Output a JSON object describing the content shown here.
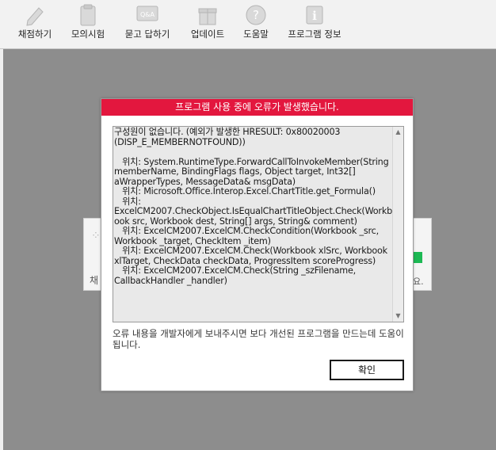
{
  "toolbar": {
    "items": [
      {
        "label": "채점하기",
        "icon": "pencil-icon"
      },
      {
        "label": "모의시험",
        "icon": "clipboard-icon"
      },
      {
        "label": "묻고 답하기",
        "icon": "qa-icon"
      },
      {
        "label": "업데이트",
        "icon": "gift-icon"
      },
      {
        "label": "도움말",
        "icon": "help-icon"
      },
      {
        "label": "프로그램 정보",
        "icon": "info-icon"
      }
    ],
    "qa_icon_text": "Q&A"
  },
  "background": {
    "left_text": "채",
    "right_text": "요."
  },
  "dialog": {
    "title": "프로그램 사용 중에 오류가 발생했습니다.",
    "message": "구성원이 없습니다. (예외가 발생한 HRESULT: 0x80020003 (DISP_E_MEMBERNOTFOUND))\n\n   위치: System.RuntimeType.ForwardCallToInvokeMember(String memberName, BindingFlags flags, Object target, Int32[] aWrapperTypes, MessageData& msgData)\n   위치: Microsoft.Office.Interop.Excel.ChartTitle.get_Formula()\n   위치: ExcelCM2007.CheckObject.IsEqualChartTitleObject.Check(Workbook src, Workbook dest, String[] args, String& comment)\n   위치: ExcelCM2007.ExcelCM.CheckCondition(Workbook _src, Workbook _target, CheckItem _item)\n   위치: ExcelCM2007.ExcelCM.Check(Workbook xlSrc, Workbook xlTarget, CheckData checkData, ProgressItem scoreProgress)\n   위치: ExcelCM2007.ExcelCM.Check(String _szFilename, CallbackHandler _handler)",
    "footnote": "오류 내용을 개발자에게 보내주시면 보다 개선된 프로그램을 만드는데 도움이 됩니다.",
    "ok_label": "확인"
  },
  "colors": {
    "title_bar": "#e3173e",
    "backdrop": "#8d8d8d"
  }
}
